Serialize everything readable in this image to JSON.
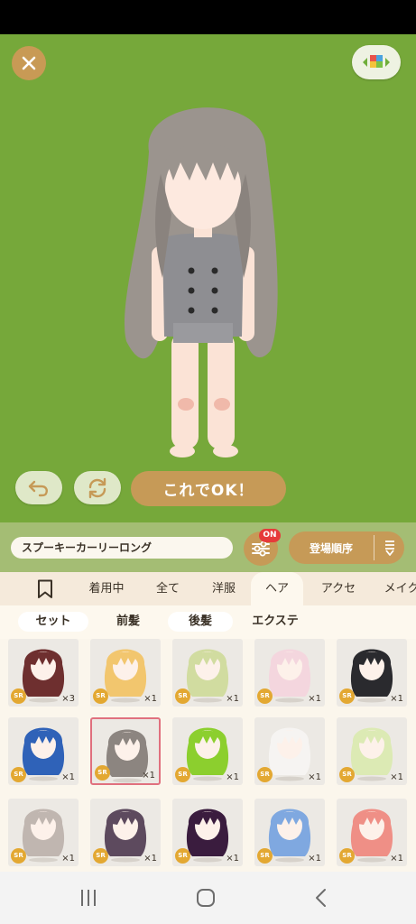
{
  "stage": {
    "background_color": "#76a83a",
    "close_icon": "close-icon",
    "background_select_icon": "palette-icon",
    "undo_icon": "undo-icon",
    "swap_icon": "swap-icon",
    "confirm_label": "これでOK！"
  },
  "toolbar": {
    "item_name": "スプーキーカーリーロング",
    "filter_badge": "ON",
    "sort_label": "登場順序"
  },
  "category_tabs": [
    "着用中",
    "全て",
    "洋服",
    "ヘア",
    "アクセ",
    "メイク"
  ],
  "category_active": "ヘア",
  "sub_tabs": [
    "セット",
    "前髪",
    "後髪",
    "エクステ"
  ],
  "items": [
    {
      "hair_color": "#6e2f2f",
      "rarity": "SR",
      "count": "×3"
    },
    {
      "hair_color": "#f2c66e",
      "rarity": "SR",
      "count": "×1"
    },
    {
      "hair_color": "#d1dca0",
      "rarity": "SR",
      "count": "×1"
    },
    {
      "hair_color": "#f4d6de",
      "rarity": "SR",
      "count": "×1"
    },
    {
      "hair_color": "#2a2a2e",
      "rarity": "SR",
      "count": "×1"
    },
    {
      "hair_color": "#2f62b8",
      "rarity": "SR",
      "count": "×1"
    },
    {
      "hair_color": "#8c8580",
      "rarity": "SR",
      "count": "×1",
      "selected": true
    },
    {
      "hair_color": "#8ccf2e",
      "rarity": "SR",
      "count": "×1"
    },
    {
      "hair_color": "#f6f4f2",
      "rarity": "SR",
      "count": "×1"
    },
    {
      "hair_color": "#dceab4",
      "rarity": "SR",
      "count": "×1"
    },
    {
      "hair_color": "#c0b6b0",
      "rarity": "SR",
      "count": "×1"
    },
    {
      "hair_color": "#5d4a5e",
      "rarity": "SR",
      "count": "×1"
    },
    {
      "hair_color": "#3a1c3e",
      "rarity": "SR",
      "count": "×1"
    },
    {
      "hair_color": "#7fa8e0",
      "rarity": "SR",
      "count": "×1"
    },
    {
      "hair_color": "#ef8f86",
      "rarity": "SR",
      "count": "×1"
    }
  ],
  "nav": {
    "recent_icon": "recent-apps-icon",
    "home_icon": "home-icon",
    "back_icon": "back-icon"
  }
}
